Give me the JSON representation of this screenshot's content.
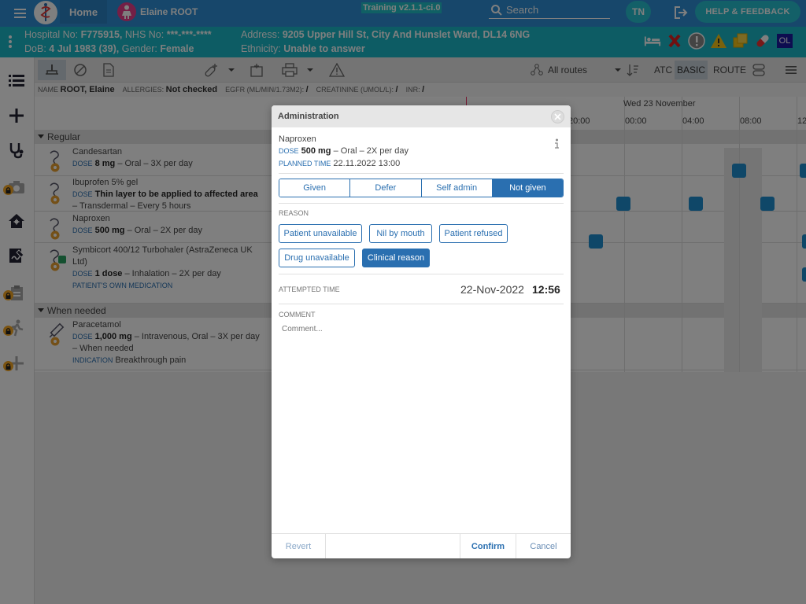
{
  "topbar": {
    "home_label": "Home",
    "patient_name": "Elaine ROOT",
    "training_badge": "Training v2.1.1-ci.0",
    "search_placeholder": "Search",
    "user_initials": "TN",
    "help_label": "HELP & FEEDBACK"
  },
  "banner": {
    "hospital_no_label": "Hospital No:",
    "hospital_no": "F775915,",
    "nhs_no_label": "NHS No:",
    "nhs_no": "***-***-****",
    "dob_label": "DoB:",
    "dob": "4 Jul 1983 (39),",
    "gender_label": "Gender:",
    "gender": "Female",
    "address_label": "Address:",
    "address": "9205 Upper Hill St, City And Hunslet Ward, DL14 6NG",
    "ethnicity_label": "Ethnicity:",
    "ethnicity": "Unable to answer",
    "ol_badge": "OL"
  },
  "toolbar": {
    "routes_label": "All routes",
    "atc_label": "ATC",
    "basic_label": "BASIC",
    "route_label": "ROUTE"
  },
  "infostrip": {
    "name_label": "NAME",
    "name": "ROOT, Elaine",
    "allergies_label": "ALLERGIES:",
    "allergies": "Not checked",
    "egfr_label": "EGFR (ML/MIN/1.73M2):",
    "egfr": "/",
    "creatinine_label": "CREATININE (UMOL/L):",
    "creatinine": "/",
    "inr_label": "INR:",
    "inr": "/"
  },
  "chart": {
    "day_header": "Wed 23 November",
    "times": [
      "20:00",
      "00:00",
      "04:00",
      "08:00",
      "12"
    ],
    "sections": [
      "Regular",
      "When needed"
    ],
    "drugs": [
      {
        "name": "Candesartan",
        "dose_label": "DOSE",
        "dose": "8 mg",
        "details": "– Oral – 3X per day"
      },
      {
        "name": "Ibuprofen 5% gel",
        "dose_label": "DOSE",
        "dose": "Thin layer to be applied to affected area",
        "details": "– Transdermal – Every 5 hours"
      },
      {
        "name": "Naproxen",
        "dose_label": "DOSE",
        "dose": "500 mg",
        "details": "– Oral – 2X per day"
      },
      {
        "name": "Symbicort 400/12 Turbohaler (AstraZeneca UK",
        "name2": "Ltd)",
        "dose_label": "DOSE",
        "dose": "1 dose",
        "details": "– Inhalation – 2X per day",
        "note": "PATIENT'S OWN MEDICATION"
      },
      {
        "name": "Paracetamol",
        "dose_label": "DOSE",
        "dose": "1,000 mg",
        "details": "– Intravenous, Oral – 3X per day",
        "details2": "– When needed",
        "ind_label": "INDICATION",
        "indication": "Breakthrough pain"
      }
    ]
  },
  "modal": {
    "title": "Administration",
    "drug": "Naproxen",
    "dose_label": "DOSE",
    "dose": "500 mg",
    "dose_details": "– Oral – 2X per day",
    "planned_label": "PLANNED TIME",
    "planned_time": "22.11.2022 13:00",
    "tabs": [
      "Given",
      "Defer",
      "Self admin",
      "Not given"
    ],
    "selected_tab": "Not given",
    "reason_label": "REASON",
    "reasons": [
      "Patient unavailable",
      "Nil by mouth",
      "Patient refused",
      "Drug unavailable",
      "Clinical reason"
    ],
    "selected_reason": "Clinical reason",
    "attempted_label": "ATTEMPTED TIME",
    "attempted_date": "22-Nov-2022",
    "attempted_time": "12:56",
    "comment_label": "COMMENT",
    "comment_placeholder": "Comment...",
    "revert_label": "Revert",
    "confirm_label": "Confirm",
    "cancel_label": "Cancel"
  },
  "colors": {
    "topbar": "#2f8fd6",
    "banner": "#1ab9c9",
    "accent": "#2a6fb0",
    "dot": "#1e8fd0",
    "lock": "#f5a623"
  }
}
